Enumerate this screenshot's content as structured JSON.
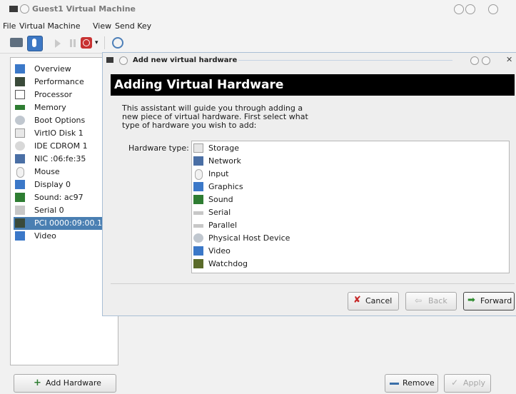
{
  "main_window": {
    "title": "Guest1 Virtual Machine",
    "menu": [
      "File",
      "Virtual Machine",
      "View",
      "Send Key"
    ],
    "sidebar_items": [
      {
        "label": "Overview",
        "icon": "monitor-icon"
      },
      {
        "label": "Performance",
        "icon": "performance-icon"
      },
      {
        "label": "Processor",
        "icon": "processor-icon"
      },
      {
        "label": "Memory",
        "icon": "memory-icon"
      },
      {
        "label": "Boot Options",
        "icon": "boot-options-icon"
      },
      {
        "label": "VirtIO Disk 1",
        "icon": "disk-icon"
      },
      {
        "label": "IDE CDROM 1",
        "icon": "cdrom-icon"
      },
      {
        "label": "NIC :06:fe:35",
        "icon": "nic-icon"
      },
      {
        "label": "Mouse",
        "icon": "mouse-icon"
      },
      {
        "label": "Display 0",
        "icon": "display-icon"
      },
      {
        "label": "Sound: ac97",
        "icon": "sound-icon"
      },
      {
        "label": "Serial 0",
        "icon": "serial-icon"
      },
      {
        "label": "PCI 0000:09:00.1",
        "icon": "pci-icon",
        "selected": true
      },
      {
        "label": "Video",
        "icon": "video-icon"
      }
    ],
    "add_hardware_label": "Add Hardware",
    "remove_label": "Remove",
    "apply_label": "Apply"
  },
  "dialog": {
    "title": "Add new virtual hardware",
    "heading": "Adding Virtual Hardware",
    "intro": "This assistant will guide you through adding a new piece of virtual hardware. First select what type of hardware you wish to add:",
    "hardware_type_label": "Hardware type:",
    "hardware_types": [
      {
        "label": "Storage",
        "icon": "storage-icon"
      },
      {
        "label": "Network",
        "icon": "network-icon"
      },
      {
        "label": "Input",
        "icon": "input-icon"
      },
      {
        "label": "Graphics",
        "icon": "graphics-icon"
      },
      {
        "label": "Sound",
        "icon": "sound-icon"
      },
      {
        "label": "Serial",
        "icon": "serial-icon"
      },
      {
        "label": "Parallel",
        "icon": "parallel-icon"
      },
      {
        "label": "Physical Host Device",
        "icon": "host-device-icon"
      },
      {
        "label": "Video",
        "icon": "video-icon"
      },
      {
        "label": "Watchdog",
        "icon": "watchdog-icon"
      }
    ],
    "cancel_label": "Cancel",
    "back_label": "Back",
    "forward_label": "Forward"
  },
  "colors": {
    "selection": "#4a7fb2",
    "header_bg": "#000000",
    "window_bg": "#f3f3f3"
  }
}
